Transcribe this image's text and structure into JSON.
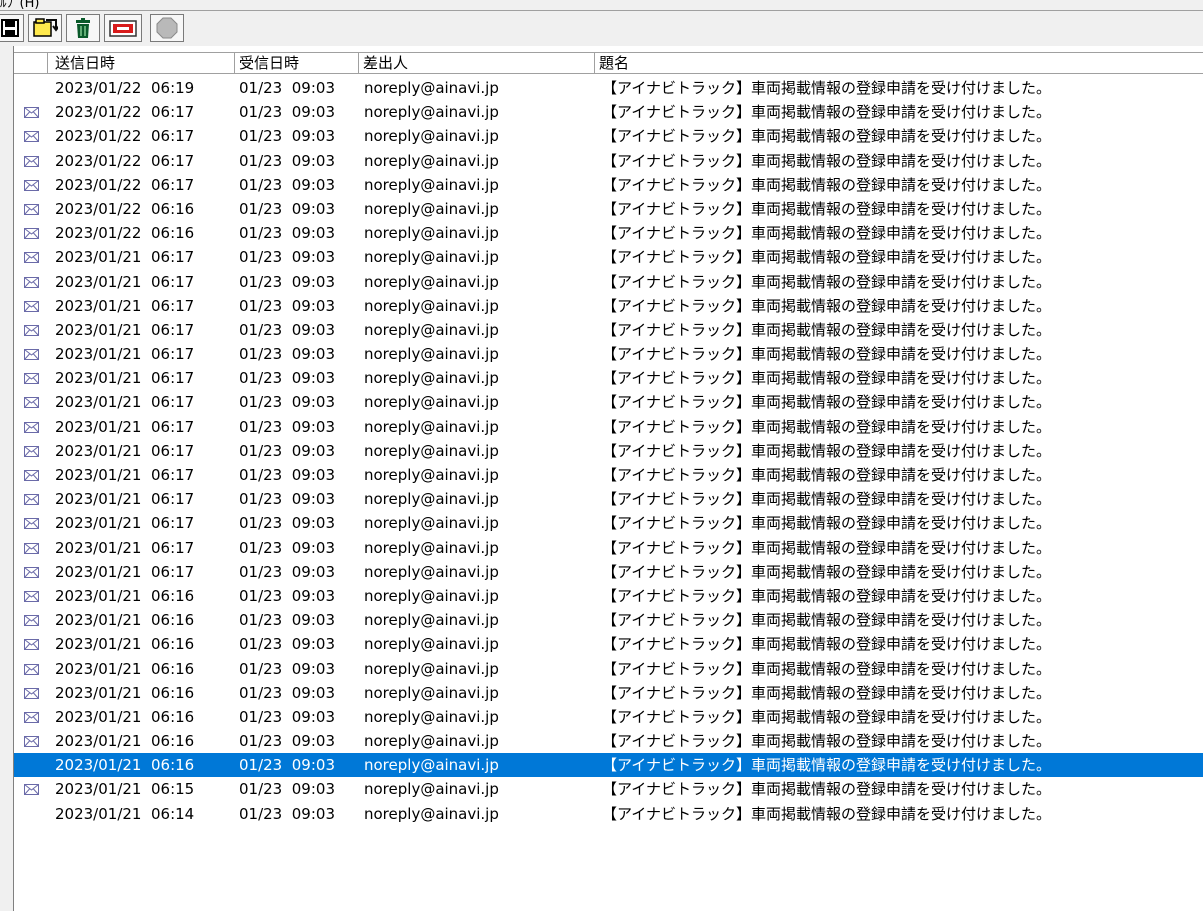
{
  "menu": {
    "partial_label": "ﾙﾌﾟ(H)"
  },
  "toolbar": {
    "buttons": [
      {
        "icon": "save-icon"
      },
      {
        "icon": "folder-move-icon"
      },
      {
        "icon": "trash-icon"
      },
      {
        "icon": "mailbox-delete-icon"
      },
      {
        "icon": "stop-icon"
      }
    ]
  },
  "columns": [
    "送信日時",
    "受信日時",
    "差出人",
    "題名"
  ],
  "colors": {
    "selected_bg": "#0078d7",
    "icon_color": "#6a6aa8"
  },
  "rows": [
    {
      "icon": false,
      "sent": "2023/01/22  06:19",
      "received": "01/23  09:03",
      "from": "noreply@ainavi.jp",
      "subject": "【アイナビトラック】車両掲載情報の登録申請を受け付けました。"
    },
    {
      "icon": true,
      "sent": "2023/01/22  06:17",
      "received": "01/23  09:03",
      "from": "noreply@ainavi.jp",
      "subject": "【アイナビトラック】車両掲載情報の登録申請を受け付けました。"
    },
    {
      "icon": true,
      "sent": "2023/01/22  06:17",
      "received": "01/23  09:03",
      "from": "noreply@ainavi.jp",
      "subject": "【アイナビトラック】車両掲載情報の登録申請を受け付けました。"
    },
    {
      "icon": true,
      "sent": "2023/01/22  06:17",
      "received": "01/23  09:03",
      "from": "noreply@ainavi.jp",
      "subject": "【アイナビトラック】車両掲載情報の登録申請を受け付けました。"
    },
    {
      "icon": true,
      "sent": "2023/01/22  06:17",
      "received": "01/23  09:03",
      "from": "noreply@ainavi.jp",
      "subject": "【アイナビトラック】車両掲載情報の登録申請を受け付けました。"
    },
    {
      "icon": true,
      "sent": "2023/01/22  06:16",
      "received": "01/23  09:03",
      "from": "noreply@ainavi.jp",
      "subject": "【アイナビトラック】車両掲載情報の登録申請を受け付けました。"
    },
    {
      "icon": true,
      "sent": "2023/01/22  06:16",
      "received": "01/23  09:03",
      "from": "noreply@ainavi.jp",
      "subject": "【アイナビトラック】車両掲載情報の登録申請を受け付けました。"
    },
    {
      "icon": true,
      "sent": "2023/01/21  06:17",
      "received": "01/23  09:03",
      "from": "noreply@ainavi.jp",
      "subject": "【アイナビトラック】車両掲載情報の登録申請を受け付けました。"
    },
    {
      "icon": true,
      "sent": "2023/01/21  06:17",
      "received": "01/23  09:03",
      "from": "noreply@ainavi.jp",
      "subject": "【アイナビトラック】車両掲載情報の登録申請を受け付けました。"
    },
    {
      "icon": true,
      "sent": "2023/01/21  06:17",
      "received": "01/23  09:03",
      "from": "noreply@ainavi.jp",
      "subject": "【アイナビトラック】車両掲載情報の登録申請を受け付けました。"
    },
    {
      "icon": true,
      "sent": "2023/01/21  06:17",
      "received": "01/23  09:03",
      "from": "noreply@ainavi.jp",
      "subject": "【アイナビトラック】車両掲載情報の登録申請を受け付けました。"
    },
    {
      "icon": true,
      "sent": "2023/01/21  06:17",
      "received": "01/23  09:03",
      "from": "noreply@ainavi.jp",
      "subject": "【アイナビトラック】車両掲載情報の登録申請を受け付けました。"
    },
    {
      "icon": true,
      "sent": "2023/01/21  06:17",
      "received": "01/23  09:03",
      "from": "noreply@ainavi.jp",
      "subject": "【アイナビトラック】車両掲載情報の登録申請を受け付けました。"
    },
    {
      "icon": true,
      "sent": "2023/01/21  06:17",
      "received": "01/23  09:03",
      "from": "noreply@ainavi.jp",
      "subject": "【アイナビトラック】車両掲載情報の登録申請を受け付けました。"
    },
    {
      "icon": true,
      "sent": "2023/01/21  06:17",
      "received": "01/23  09:03",
      "from": "noreply@ainavi.jp",
      "subject": "【アイナビトラック】車両掲載情報の登録申請を受け付けました。"
    },
    {
      "icon": true,
      "sent": "2023/01/21  06:17",
      "received": "01/23  09:03",
      "from": "noreply@ainavi.jp",
      "subject": "【アイナビトラック】車両掲載情報の登録申請を受け付けました。"
    },
    {
      "icon": true,
      "sent": "2023/01/21  06:17",
      "received": "01/23  09:03",
      "from": "noreply@ainavi.jp",
      "subject": "【アイナビトラック】車両掲載情報の登録申請を受け付けました。"
    },
    {
      "icon": true,
      "sent": "2023/01/21  06:17",
      "received": "01/23  09:03",
      "from": "noreply@ainavi.jp",
      "subject": "【アイナビトラック】車両掲載情報の登録申請を受け付けました。"
    },
    {
      "icon": true,
      "sent": "2023/01/21  06:17",
      "received": "01/23  09:03",
      "from": "noreply@ainavi.jp",
      "subject": "【アイナビトラック】車両掲載情報の登録申請を受け付けました。"
    },
    {
      "icon": true,
      "sent": "2023/01/21  06:17",
      "received": "01/23  09:03",
      "from": "noreply@ainavi.jp",
      "subject": "【アイナビトラック】車両掲載情報の登録申請を受け付けました。"
    },
    {
      "icon": true,
      "sent": "2023/01/21  06:17",
      "received": "01/23  09:03",
      "from": "noreply@ainavi.jp",
      "subject": "【アイナビトラック】車両掲載情報の登録申請を受け付けました。"
    },
    {
      "icon": true,
      "sent": "2023/01/21  06:16",
      "received": "01/23  09:03",
      "from": "noreply@ainavi.jp",
      "subject": "【アイナビトラック】車両掲載情報の登録申請を受け付けました。"
    },
    {
      "icon": true,
      "sent": "2023/01/21  06:16",
      "received": "01/23  09:03",
      "from": "noreply@ainavi.jp",
      "subject": "【アイナビトラック】車両掲載情報の登録申請を受け付けました。"
    },
    {
      "icon": true,
      "sent": "2023/01/21  06:16",
      "received": "01/23  09:03",
      "from": "noreply@ainavi.jp",
      "subject": "【アイナビトラック】車両掲載情報の登録申請を受け付けました。"
    },
    {
      "icon": true,
      "sent": "2023/01/21  06:16",
      "received": "01/23  09:03",
      "from": "noreply@ainavi.jp",
      "subject": "【アイナビトラック】車両掲載情報の登録申請を受け付けました。"
    },
    {
      "icon": true,
      "sent": "2023/01/21  06:16",
      "received": "01/23  09:03",
      "from": "noreply@ainavi.jp",
      "subject": "【アイナビトラック】車両掲載情報の登録申請を受け付けました。"
    },
    {
      "icon": true,
      "sent": "2023/01/21  06:16",
      "received": "01/23  09:03",
      "from": "noreply@ainavi.jp",
      "subject": "【アイナビトラック】車両掲載情報の登録申請を受け付けました。"
    },
    {
      "icon": true,
      "sent": "2023/01/21  06:16",
      "received": "01/23  09:03",
      "from": "noreply@ainavi.jp",
      "subject": "【アイナビトラック】車両掲載情報の登録申請を受け付けました。"
    },
    {
      "icon": false,
      "selected": true,
      "sent": "2023/01/21  06:16",
      "received": "01/23  09:03",
      "from": "noreply@ainavi.jp",
      "subject": "【アイナビトラック】車両掲載情報の登録申請を受け付けました。"
    },
    {
      "icon": true,
      "sent": "2023/01/21  06:15",
      "received": "01/23  09:03",
      "from": "noreply@ainavi.jp",
      "subject": "【アイナビトラック】車両掲載情報の登録申請を受け付けました。"
    },
    {
      "icon": false,
      "sent": "2023/01/21  06:14",
      "received": "01/23  09:03",
      "from": "noreply@ainavi.jp",
      "subject": "【アイナビトラック】車両掲載情報の登録申請を受け付けました。"
    }
  ]
}
